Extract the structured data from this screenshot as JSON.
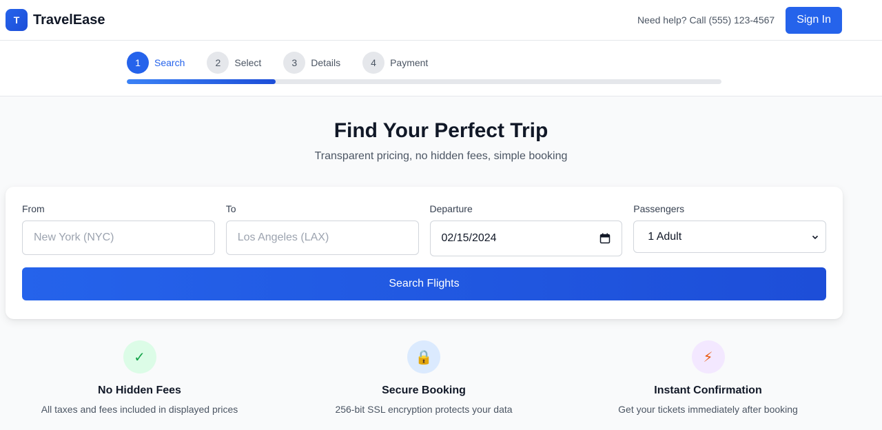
{
  "header": {
    "logo_letter": "T",
    "brand_name": "TravelEase",
    "help_text": "Need help? Call (555) 123-4567",
    "signin_label": "Sign In"
  },
  "progress": {
    "steps": [
      {
        "number": "1",
        "label": "Search"
      },
      {
        "number": "2",
        "label": "Select"
      },
      {
        "number": "3",
        "label": "Details"
      },
      {
        "number": "4",
        "label": "Payment"
      }
    ],
    "active_step": 1,
    "completion": 0.25
  },
  "hero": {
    "title": "Find Your Perfect Trip",
    "subtitle": "Transparent pricing, no hidden fees, simple booking"
  },
  "search_form": {
    "from_label": "From",
    "from_placeholder": "New York (NYC)",
    "to_label": "To",
    "to_placeholder": "Los Angeles (LAX)",
    "departure_label": "Departure",
    "departure_value": "02/15/2024",
    "passengers_label": "Passengers",
    "passengers_value": "1 Adult",
    "submit_label": "Search Flights"
  },
  "features": [
    {
      "icon": "check-icon",
      "glyph": "✓",
      "title": "No Hidden Fees",
      "description": "All taxes and fees included in displayed prices"
    },
    {
      "icon": "lock-icon",
      "glyph": "🔒",
      "title": "Secure Booking",
      "description": "256-bit SSL encryption protects your data"
    },
    {
      "icon": "lightning-icon",
      "glyph": "⚡",
      "title": "Instant Confirmation",
      "description": "Get your tickets immediately after booking"
    }
  ],
  "colors": {
    "primary": "#2563eb",
    "primary_dark": "#1d4ed8",
    "text": "#111827",
    "muted": "#4b5563"
  }
}
